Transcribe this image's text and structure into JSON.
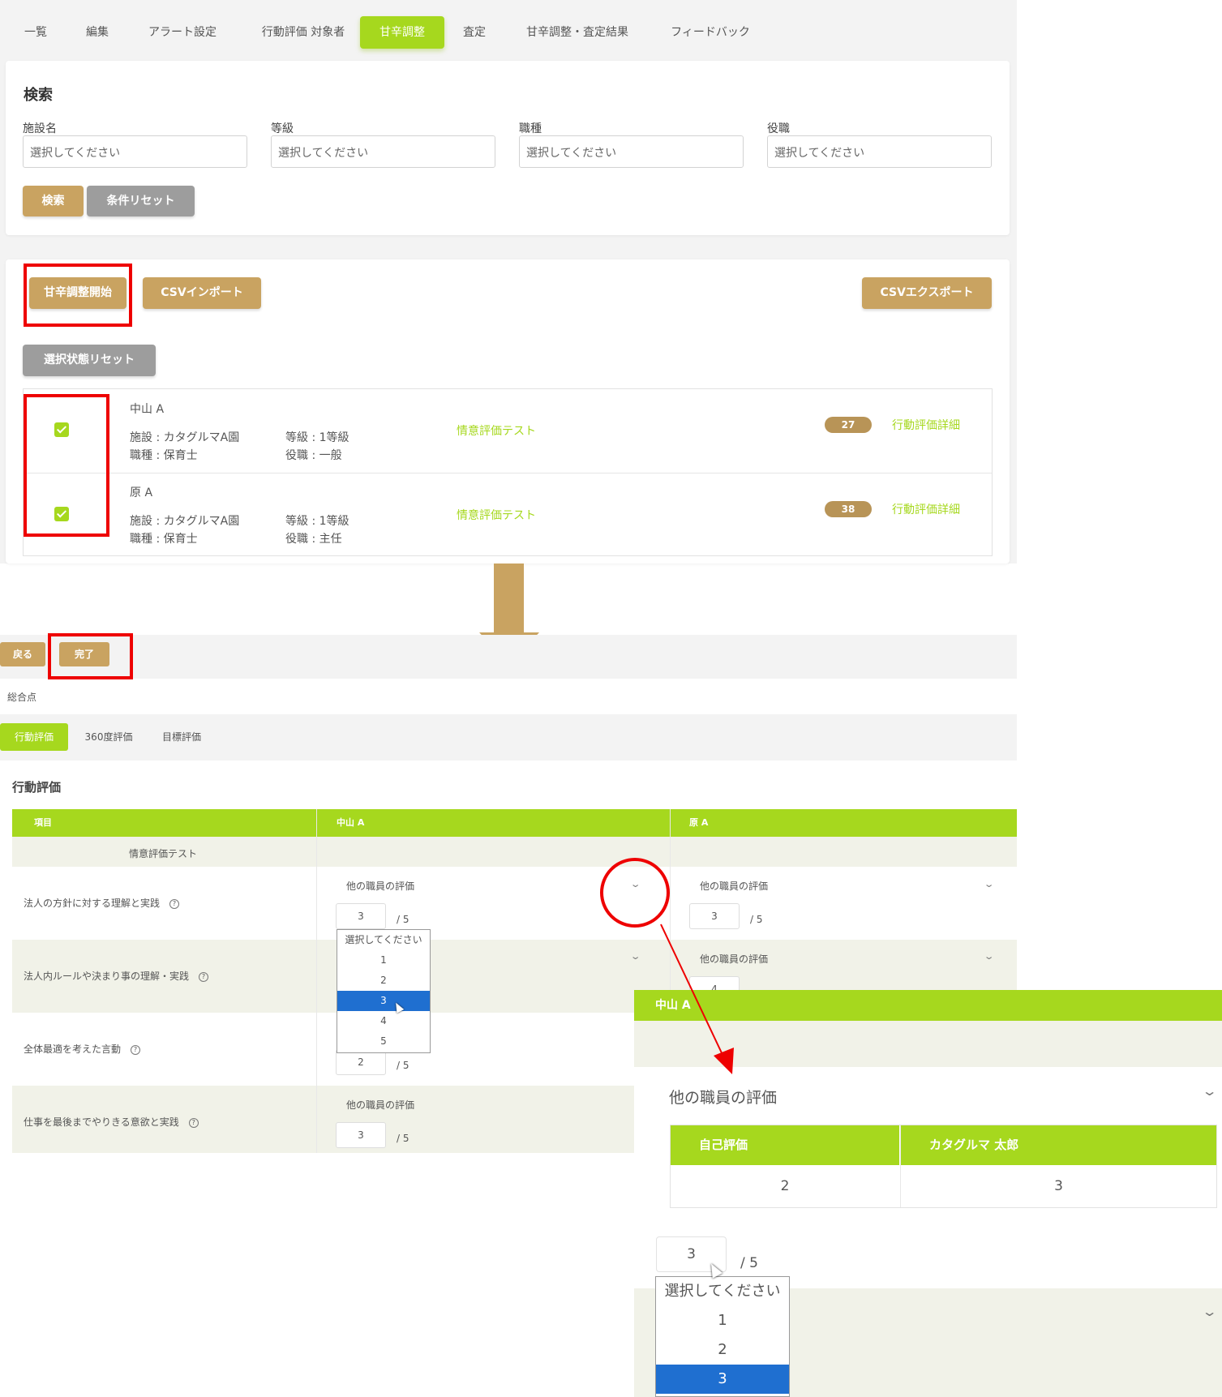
{
  "colors": {
    "accent_green": "#a6d81e",
    "gold": "#c9a361",
    "gray_button": "#9d9d9d",
    "highlight_red": "#ee0000",
    "select_blue": "#1f6fd0"
  },
  "tabs": {
    "t0": "一覧",
    "t1": "編集",
    "t2": "アラート設定",
    "t3": "行動評価 対象者",
    "t4": "甘辛調整",
    "t5": "査定",
    "t6": "甘辛調整・査定結果",
    "t7": "フィードバック",
    "active": "甘辛調整"
  },
  "search": {
    "title": "検索",
    "f0": {
      "label": "施設名",
      "placeholder": "選択してください"
    },
    "f1": {
      "label": "等級",
      "placeholder": "選択してください"
    },
    "f2": {
      "label": "職種",
      "placeholder": "選択してください"
    },
    "f3": {
      "label": "役職",
      "placeholder": "選択してください"
    },
    "search_button": "検索",
    "reset_button": "条件リセット"
  },
  "actions": {
    "start_adjust": "甘辛調整開始",
    "csv_import": "CSVインポート",
    "csv_export": "CSVエクスポート",
    "selection_reset": "選択状態リセット"
  },
  "employees": {
    "e0": {
      "name": "中山 A",
      "facility": "施設 : カタグルマA園",
      "job": "職種 : 保育士",
      "grade": "等級 : 1等級",
      "position": "役職 : 一般",
      "test": "情意評価テスト",
      "score": "27",
      "detail": "行動評価詳細",
      "checked": true
    },
    "e1": {
      "name": "原 A",
      "facility": "施設 : カタグルマA園",
      "job": "職種 : 保育士",
      "grade": "等級 : 1等級",
      "position": "役職 : 主任",
      "test": "情意評価テスト",
      "score": "38",
      "detail": "行動評価詳細",
      "checked": true
    }
  },
  "adjust": {
    "back": "戻る",
    "done": "完了",
    "total_label": "総合点",
    "subtabs": {
      "s0": "行動評価",
      "s1": "360度評価",
      "s2": "目標評価"
    },
    "section_title": "行動評価",
    "table": {
      "h0": "項目",
      "h1": "中山 A",
      "h2": "原 A",
      "category": "情意評価テスト",
      "other_eval": "他の職員の評価",
      "max": "/  5",
      "rows": {
        "r0": {
          "item": "法人の方針に対する理解と実践",
          "a": "3",
          "b": "3"
        },
        "r1": {
          "item": "法人内ルールや決まり事の理解・実践",
          "b": "4"
        },
        "r2": {
          "item": "全体最適を考えた言動",
          "a": "2"
        },
        "r3": {
          "item": "仕事を最後までやりきる意欲と実践",
          "a": "3"
        }
      }
    },
    "dropdown": {
      "o0": "選択してください",
      "o1": "1",
      "o2": "2",
      "o3": "3",
      "o4": "4",
      "o5": "5",
      "selected": "3"
    }
  },
  "zoom": {
    "title": "中山 A",
    "other_eval": "他の職員の評価",
    "columns": {
      "c0": "自己評価",
      "c1": "カタグルマ 太郎"
    },
    "values": {
      "v0": "2",
      "v1": "3"
    },
    "select_value": "3",
    "max": "/  5",
    "dropdown": {
      "o0": "選択してください",
      "o1": "1",
      "o2": "2",
      "o3": "3"
    }
  }
}
